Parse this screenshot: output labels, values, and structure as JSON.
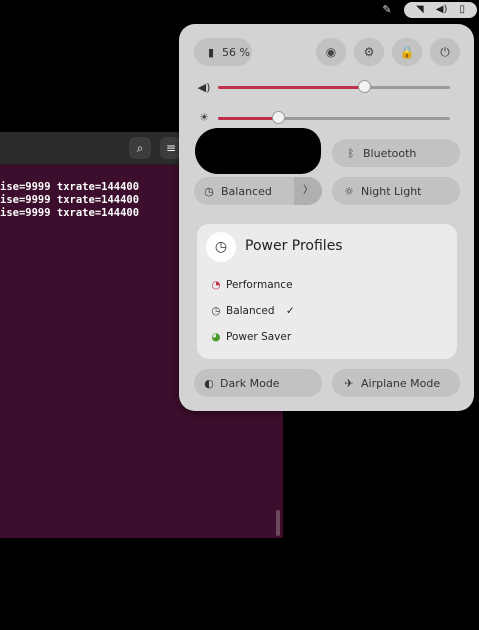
{
  "tray": {
    "left_icon": "✎",
    "wifi_icon": "◥",
    "volume_icon": "◀)",
    "battery_icon": "▯"
  },
  "terminal": {
    "search_icon": "⌕",
    "menu_icon": "≡",
    "lines": [
      "ise=9999 txrate=144400",
      "ise=9999 txrate=144400",
      "ise=9999 txrate=144400"
    ]
  },
  "quick_settings": {
    "battery": {
      "icon": "▮",
      "label": "56 %"
    },
    "buttons": {
      "screenshot_icon": "◉",
      "settings_icon": "⚙",
      "lock_icon": "🔒",
      "power_icon": "⏻"
    },
    "volume": {
      "icon": "◀)",
      "level": 0.63
    },
    "brightness": {
      "icon": "☀",
      "level": 0.26
    },
    "bluetooth": {
      "icon": "ᛒ",
      "label": "Bluetooth"
    },
    "power_mode": {
      "icon": "◷",
      "label": "Balanced",
      "arrow": "〉"
    },
    "night_light": {
      "icon": "☼",
      "label": "Night Light"
    },
    "power_profiles": {
      "icon": "◷",
      "title": "Power Profiles",
      "items": [
        {
          "icon": "◔",
          "label": "Performance",
          "check": "",
          "color": "#c0304a"
        },
        {
          "icon": "◷",
          "label": "Balanced",
          "check": "✓",
          "color": "#333333"
        },
        {
          "icon": "◕",
          "label": "Power Saver",
          "check": "",
          "color": "#4a9a2a"
        }
      ]
    },
    "dark_mode": {
      "icon": "◐",
      "label": "Dark Mode"
    },
    "airplane_mode": {
      "icon": "✈",
      "label": "Airplane Mode"
    }
  }
}
